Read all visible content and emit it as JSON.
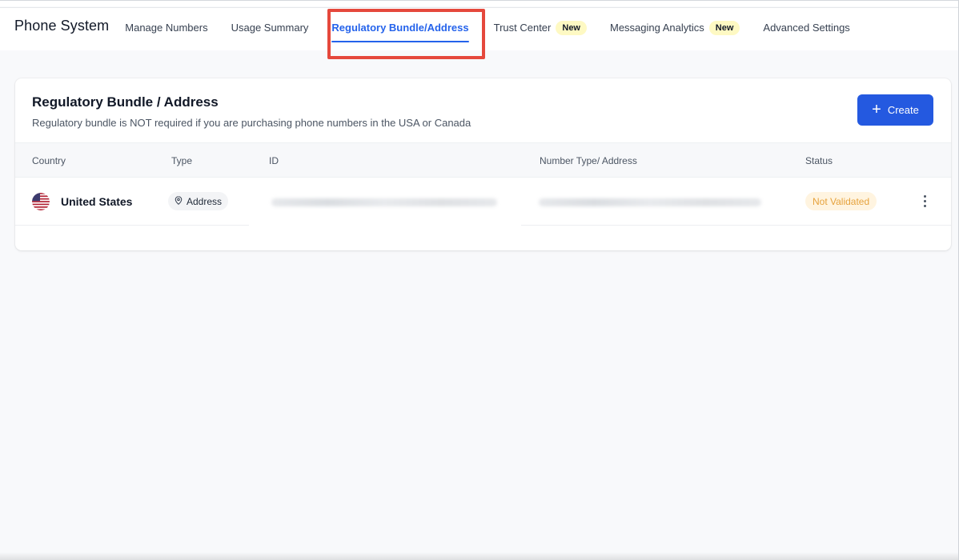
{
  "app": {
    "title": "Phone System"
  },
  "nav": {
    "tabs": [
      {
        "label": "Manage Numbers"
      },
      {
        "label": "Usage Summary"
      },
      {
        "label": "Regulatory Bundle/Address",
        "active": true
      },
      {
        "label": "Trust Center",
        "badge": "New"
      },
      {
        "label": "Messaging Analytics",
        "badge": "New"
      },
      {
        "label": "Advanced Settings"
      }
    ]
  },
  "card": {
    "title": "Regulatory Bundle / Address",
    "subtitle": "Regulatory bundle is NOT required if you are purchasing phone numbers in the USA or Canada",
    "create_label": "Create"
  },
  "table": {
    "columns": [
      "Country",
      "Type",
      "ID",
      "Number Type/ Address",
      "Status"
    ],
    "rows": [
      {
        "country": "United States",
        "type": "Address",
        "status": "Not Validated"
      }
    ]
  },
  "colors": {
    "accent": "#2563eb",
    "create_button": "#2459e0",
    "highlight": "#e5483c",
    "new_badge_bg": "#fef9c3",
    "status_text": "#e6a23c"
  },
  "icons": {
    "flag": "us-flag-icon",
    "type": "location-pin-icon",
    "create": "plus-icon",
    "row_menu": "more-vertical-icon"
  }
}
